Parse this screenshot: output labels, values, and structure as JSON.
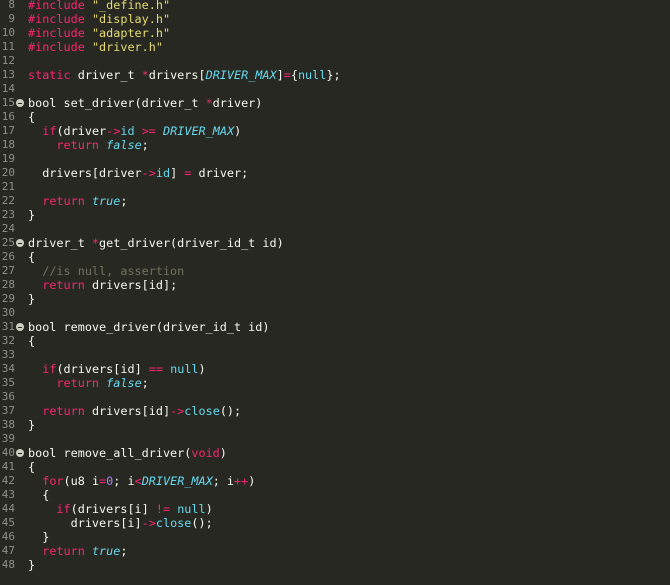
{
  "editor": {
    "colors": {
      "background": "#272822",
      "text": "#f8f8f2",
      "keyword": "#f92672",
      "string": "#e6db74",
      "number": "#ae81ff",
      "constant": "#66d9ef",
      "comment": "#75715e",
      "line_number": "#8f908a"
    },
    "lines": [
      {
        "n": "8",
        "fold": false,
        "tokens": [
          {
            "t": "kw",
            "v": "#include"
          },
          {
            "t": "plain",
            "v": " "
          },
          {
            "t": "str",
            "v": "\"_define.h\""
          }
        ]
      },
      {
        "n": "9",
        "fold": false,
        "tokens": [
          {
            "t": "kw",
            "v": "#include"
          },
          {
            "t": "plain",
            "v": " "
          },
          {
            "t": "str",
            "v": "\"display.h\""
          }
        ]
      },
      {
        "n": "10",
        "fold": false,
        "tokens": [
          {
            "t": "kw",
            "v": "#include"
          },
          {
            "t": "plain",
            "v": " "
          },
          {
            "t": "str",
            "v": "\"adapter.h\""
          }
        ]
      },
      {
        "n": "11",
        "fold": false,
        "tokens": [
          {
            "t": "kw",
            "v": "#include"
          },
          {
            "t": "plain",
            "v": " "
          },
          {
            "t": "str",
            "v": "\"driver.h\""
          }
        ]
      },
      {
        "n": "12",
        "fold": false,
        "tokens": []
      },
      {
        "n": "13",
        "fold": false,
        "tokens": [
          {
            "t": "kw",
            "v": "static"
          },
          {
            "t": "plain",
            "v": " driver_t "
          },
          {
            "t": "kw",
            "v": "*"
          },
          {
            "t": "plain",
            "v": "drivers["
          },
          {
            "t": "const",
            "v": "DRIVER_MAX"
          },
          {
            "t": "plain",
            "v": "]"
          },
          {
            "t": "kw",
            "v": "="
          },
          {
            "t": "plain",
            "v": "{"
          },
          {
            "t": "ptr",
            "v": "null"
          },
          {
            "t": "plain",
            "v": "};"
          }
        ]
      },
      {
        "n": "14",
        "fold": false,
        "tokens": []
      },
      {
        "n": "15",
        "fold": true,
        "tokens": [
          {
            "t": "plain",
            "v": "bool set_driver(driver_t "
          },
          {
            "t": "kw",
            "v": "*"
          },
          {
            "t": "plain",
            "v": "driver)"
          }
        ]
      },
      {
        "n": "16",
        "fold": false,
        "tokens": [
          {
            "t": "plain",
            "v": "{"
          }
        ]
      },
      {
        "n": "17",
        "fold": false,
        "tokens": [
          {
            "t": "plain",
            "v": "  "
          },
          {
            "t": "kw",
            "v": "if"
          },
          {
            "t": "plain",
            "v": "(driver"
          },
          {
            "t": "kw",
            "v": "->"
          },
          {
            "t": "ptr",
            "v": "id"
          },
          {
            "t": "plain",
            "v": " "
          },
          {
            "t": "kw",
            "v": ">="
          },
          {
            "t": "plain",
            "v": " "
          },
          {
            "t": "const",
            "v": "DRIVER_MAX"
          },
          {
            "t": "plain",
            "v": ")"
          }
        ]
      },
      {
        "n": "18",
        "fold": false,
        "tokens": [
          {
            "t": "plain",
            "v": "    "
          },
          {
            "t": "kw",
            "v": "return"
          },
          {
            "t": "plain",
            "v": " "
          },
          {
            "t": "bool",
            "v": "false"
          },
          {
            "t": "plain",
            "v": ";"
          }
        ]
      },
      {
        "n": "19",
        "fold": false,
        "tokens": []
      },
      {
        "n": "20",
        "fold": false,
        "tokens": [
          {
            "t": "plain",
            "v": "  drivers[driver"
          },
          {
            "t": "kw",
            "v": "->"
          },
          {
            "t": "ptr",
            "v": "id"
          },
          {
            "t": "plain",
            "v": "] "
          },
          {
            "t": "kw",
            "v": "="
          },
          {
            "t": "plain",
            "v": " driver;"
          }
        ]
      },
      {
        "n": "21",
        "fold": false,
        "tokens": []
      },
      {
        "n": "22",
        "fold": false,
        "tokens": [
          {
            "t": "plain",
            "v": "  "
          },
          {
            "t": "kw",
            "v": "return"
          },
          {
            "t": "plain",
            "v": " "
          },
          {
            "t": "bool",
            "v": "true"
          },
          {
            "t": "plain",
            "v": ";"
          }
        ]
      },
      {
        "n": "23",
        "fold": false,
        "tokens": [
          {
            "t": "plain",
            "v": "}"
          }
        ]
      },
      {
        "n": "24",
        "fold": false,
        "tokens": []
      },
      {
        "n": "25",
        "fold": true,
        "tokens": [
          {
            "t": "plain",
            "v": "driver_t "
          },
          {
            "t": "kw",
            "v": "*"
          },
          {
            "t": "plain",
            "v": "get_driver(driver_id_t id)"
          }
        ]
      },
      {
        "n": "26",
        "fold": false,
        "tokens": [
          {
            "t": "plain",
            "v": "{"
          }
        ]
      },
      {
        "n": "27",
        "fold": false,
        "tokens": [
          {
            "t": "plain",
            "v": "  "
          },
          {
            "t": "com",
            "v": "//is null, assertion"
          }
        ]
      },
      {
        "n": "28",
        "fold": false,
        "tokens": [
          {
            "t": "plain",
            "v": "  "
          },
          {
            "t": "kw",
            "v": "return"
          },
          {
            "t": "plain",
            "v": " drivers[id];"
          }
        ]
      },
      {
        "n": "29",
        "fold": false,
        "tokens": [
          {
            "t": "plain",
            "v": "}"
          }
        ]
      },
      {
        "n": "30",
        "fold": false,
        "tokens": []
      },
      {
        "n": "31",
        "fold": true,
        "tokens": [
          {
            "t": "plain",
            "v": "bool remove_driver(driver_id_t id)"
          }
        ]
      },
      {
        "n": "32",
        "fold": false,
        "tokens": [
          {
            "t": "plain",
            "v": "{"
          }
        ]
      },
      {
        "n": "33",
        "fold": false,
        "tokens": []
      },
      {
        "n": "34",
        "fold": false,
        "tokens": [
          {
            "t": "plain",
            "v": "  "
          },
          {
            "t": "kw",
            "v": "if"
          },
          {
            "t": "plain",
            "v": "(drivers[id] "
          },
          {
            "t": "kw",
            "v": "=="
          },
          {
            "t": "plain",
            "v": " "
          },
          {
            "t": "ptr",
            "v": "null"
          },
          {
            "t": "plain",
            "v": ")"
          }
        ]
      },
      {
        "n": "35",
        "fold": false,
        "tokens": [
          {
            "t": "plain",
            "v": "    "
          },
          {
            "t": "kw",
            "v": "return"
          },
          {
            "t": "plain",
            "v": " "
          },
          {
            "t": "bool",
            "v": "false"
          },
          {
            "t": "plain",
            "v": ";"
          }
        ]
      },
      {
        "n": "36",
        "fold": false,
        "tokens": []
      },
      {
        "n": "37",
        "fold": false,
        "tokens": [
          {
            "t": "plain",
            "v": "  "
          },
          {
            "t": "kw",
            "v": "return"
          },
          {
            "t": "plain",
            "v": " drivers[id]"
          },
          {
            "t": "kw",
            "v": "->"
          },
          {
            "t": "ptr",
            "v": "close"
          },
          {
            "t": "plain",
            "v": "();"
          }
        ]
      },
      {
        "n": "38",
        "fold": false,
        "tokens": [
          {
            "t": "plain",
            "v": "}"
          }
        ]
      },
      {
        "n": "39",
        "fold": false,
        "tokens": []
      },
      {
        "n": "40",
        "fold": true,
        "tokens": [
          {
            "t": "plain",
            "v": "bool remove_all_driver("
          },
          {
            "t": "kw",
            "v": "void"
          },
          {
            "t": "plain",
            "v": ")"
          }
        ]
      },
      {
        "n": "41",
        "fold": false,
        "tokens": [
          {
            "t": "plain",
            "v": "{"
          }
        ]
      },
      {
        "n": "42",
        "fold": false,
        "tokens": [
          {
            "t": "plain",
            "v": "  "
          },
          {
            "t": "kw",
            "v": "for"
          },
          {
            "t": "plain",
            "v": "(u8 i"
          },
          {
            "t": "kw",
            "v": "="
          },
          {
            "t": "num",
            "v": "0"
          },
          {
            "t": "plain",
            "v": "; i"
          },
          {
            "t": "kw",
            "v": "<"
          },
          {
            "t": "const",
            "v": "DRIVER_MAX"
          },
          {
            "t": "plain",
            "v": "; i"
          },
          {
            "t": "kw",
            "v": "++"
          },
          {
            "t": "plain",
            "v": ")"
          }
        ]
      },
      {
        "n": "43",
        "fold": false,
        "tokens": [
          {
            "t": "plain",
            "v": "  {"
          }
        ]
      },
      {
        "n": "44",
        "fold": false,
        "tokens": [
          {
            "t": "plain",
            "v": "    "
          },
          {
            "t": "kw",
            "v": "if"
          },
          {
            "t": "plain",
            "v": "(drivers[i] "
          },
          {
            "t": "kw",
            "v": "!="
          },
          {
            "t": "plain",
            "v": " "
          },
          {
            "t": "ptr",
            "v": "null"
          },
          {
            "t": "plain",
            "v": ")"
          }
        ]
      },
      {
        "n": "45",
        "fold": false,
        "tokens": [
          {
            "t": "plain",
            "v": "      drivers[i]"
          },
          {
            "t": "kw",
            "v": "->"
          },
          {
            "t": "ptr",
            "v": "close"
          },
          {
            "t": "plain",
            "v": "();"
          }
        ]
      },
      {
        "n": "46",
        "fold": false,
        "tokens": [
          {
            "t": "plain",
            "v": "  }"
          }
        ]
      },
      {
        "n": "47",
        "fold": false,
        "tokens": [
          {
            "t": "plain",
            "v": "  "
          },
          {
            "t": "kw",
            "v": "return"
          },
          {
            "t": "plain",
            "v": " "
          },
          {
            "t": "bool",
            "v": "true"
          },
          {
            "t": "plain",
            "v": ";"
          }
        ]
      },
      {
        "n": "48",
        "fold": false,
        "tokens": [
          {
            "t": "plain",
            "v": "}"
          }
        ]
      }
    ]
  }
}
